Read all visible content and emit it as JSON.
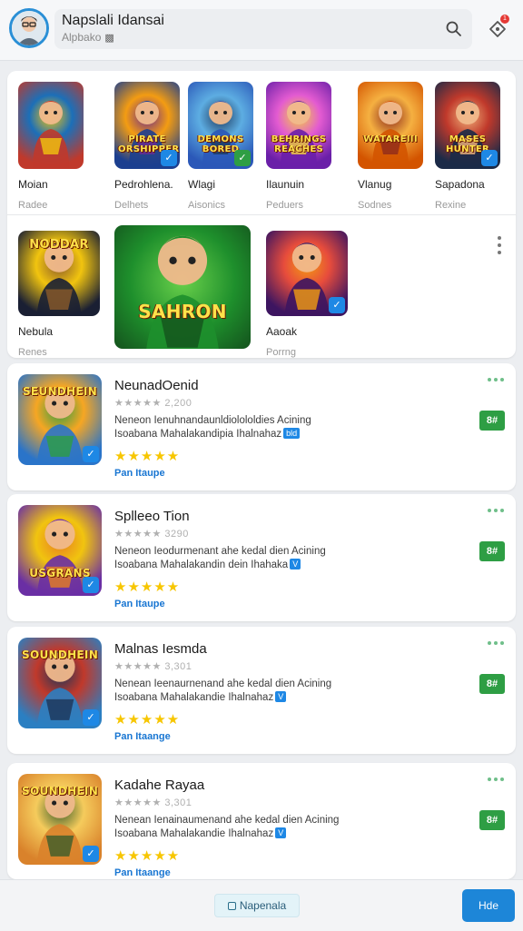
{
  "header": {
    "title": "Napslali Idansai",
    "subtitle": "Alpbako",
    "notification_count": "1"
  },
  "grid": {
    "row1": [
      {
        "name": "Moian",
        "category": "Radee",
        "art_text": "",
        "badge": "",
        "colors": [
          "#c0392b",
          "#1c6fb8",
          "#f1c40f"
        ]
      },
      {
        "name": "Pedrohlena.",
        "category": "Delhets",
        "art_text": "PIRATE ORSHIPPER",
        "badge": "check",
        "colors": [
          "#1c3f8f",
          "#f39c12",
          "#6c2b8e"
        ]
      },
      {
        "name": "Wlagi",
        "category": "Aisonics",
        "art_text": "DEMONS BORED",
        "badge": "check-green",
        "colors": [
          "#2b58b8",
          "#5dade2",
          "#1e3a5f"
        ]
      },
      {
        "name": "Ilaunuin",
        "category": "Peduers",
        "art_text": "BEHRINGS REACHES",
        "badge": "",
        "colors": [
          "#6a1fa8",
          "#e35bd1",
          "#f4d03f"
        ]
      },
      {
        "name": "Vlanug",
        "category": "Sodnes",
        "art_text": "WATAREIII",
        "badge": "",
        "colors": [
          "#d35400",
          "#f5b041",
          "#8e2b1c"
        ]
      },
      {
        "name": "Sapadona",
        "category": "Rexine",
        "art_text": "MASES HUNTER",
        "badge": "check",
        "colors": [
          "#1b2a47",
          "#c0392b",
          "#f0b27a"
        ]
      }
    ],
    "row2": [
      {
        "name": "Nebula",
        "category": "Renes",
        "art_text": "NODDAR",
        "badge": "",
        "colors": [
          "#1a1f33",
          "#f1c40f",
          "#8a5a2b"
        ]
      },
      {
        "name": "",
        "category": "",
        "art_text": "SAHRON",
        "badge": "",
        "colors": [
          "#1e8f2c",
          "#6ad14b",
          "#14521d"
        ],
        "wide": true
      },
      {
        "name": "Aaoak",
        "category": "Porrng",
        "art_text": "",
        "badge": "check",
        "colors": [
          "#3d1560",
          "#e74c3c",
          "#f39c12"
        ]
      }
    ]
  },
  "list": [
    {
      "title": "NeunadOenid",
      "rating_text": "★★★★★ 2,200",
      "desc_line1": "Neneon Ienuhnandaunldiolololdies Acining",
      "desc_line2": "Isoabana Mahalakandipia Ihalnahaz",
      "desc_badge": "bld",
      "link": "Pan Itaupe",
      "button": "8#",
      "art_text": "SEUNDHEIN",
      "colors": [
        "#2a74c9",
        "#f6a623",
        "#2e9e44"
      ]
    },
    {
      "title": "Splleeo Tion",
      "rating_text": "★★★★★ 3290",
      "desc_line1": "Neneon Ieodurmenant ahe kedal dien Acining",
      "desc_line2": "Isoabana Mahalakandin dein Ihahaka",
      "desc_badge": "V",
      "link": "Pan Itaupe",
      "button": "8#",
      "art_text": "USGRANS",
      "colors": [
        "#6a2fa4",
        "#f1c40f",
        "#e67e22"
      ]
    },
    {
      "title": "Malnas Iesmda",
      "rating_text": "★★★★★ 3,301",
      "desc_line1": "Nenean Ieenaurnenand ahe kedal dien Acining",
      "desc_line2": "Isoabana Mahalakandie Ihalnahaz",
      "desc_badge": "V",
      "link": "Pan Itaange",
      "button": "8#",
      "art_text": "SOUNDHEIN",
      "colors": [
        "#2b7fc2",
        "#c0392b",
        "#1d3557"
      ]
    },
    {
      "title": "Kadahe Rayaa",
      "rating_text": "★★★★★ 3,301",
      "desc_line1": "Nenean Ienainaumenand ahe kedal dien Acining",
      "desc_line2": "Isoabana Mahalakandie Ihalnahaz",
      "desc_badge": "V",
      "link": "Pan Itaange",
      "button": "8#",
      "art_text": "SOUNDHEIN",
      "colors": [
        "#d9822b",
        "#f5cb5c",
        "#3b5d2a"
      ]
    }
  ],
  "bottom": {
    "chip_label": "Napenala",
    "primary_label": "Hde"
  },
  "colors": {
    "accent": "#1d86d8",
    "star": "#f7c600",
    "get_button": "#2e9e44",
    "link": "#1976d2"
  }
}
